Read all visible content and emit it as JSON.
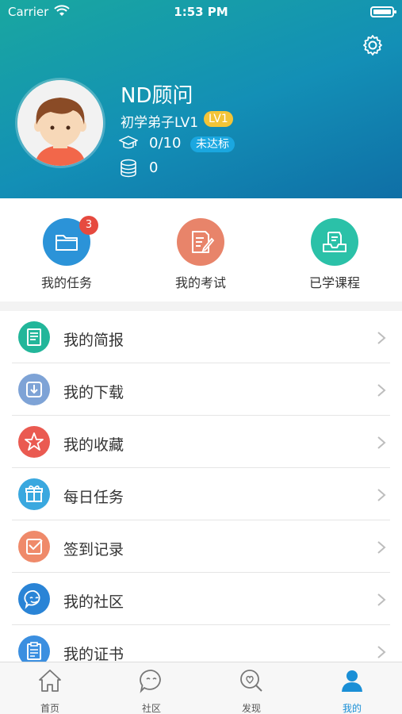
{
  "status_bar": {
    "carrier": "Carrier",
    "time": "1:53 PM"
  },
  "profile": {
    "name": "ND顾问",
    "level_title": "初学弟子LV1",
    "level_badge": "LV1",
    "progress": "0/10",
    "progress_status": "未达标",
    "coins": "0"
  },
  "quick_actions": {
    "tasks": {
      "label": "我的任务",
      "count": "3",
      "color": "#2b93d8"
    },
    "exams": {
      "label": "我的考试",
      "color": "#e8846a"
    },
    "courses": {
      "label": "已学课程",
      "color": "#2bc1a8"
    }
  },
  "menu": [
    {
      "label": "我的简报",
      "icon": "report-icon",
      "color": "#22b69a"
    },
    {
      "label": "我的下载",
      "icon": "download-icon",
      "color": "#7ea3d6"
    },
    {
      "label": "我的收藏",
      "icon": "star-icon",
      "color": "#ea5a51"
    },
    {
      "label": "每日任务",
      "icon": "gift-icon",
      "color": "#3aa8df"
    },
    {
      "label": "签到记录",
      "icon": "checkin-icon",
      "color": "#ef8a6a"
    },
    {
      "label": "我的社区",
      "icon": "chat-icon",
      "color": "#2a84d6"
    },
    {
      "label": "我的证书",
      "icon": "certificate-icon",
      "color": "#3b8fe0"
    }
  ],
  "tabs": {
    "home": "首页",
    "community": "社区",
    "discover": "发现",
    "mine": "我的"
  },
  "colors": {
    "accent": "#1a8fd6",
    "header_start": "#19a7a0",
    "header_end": "#0f6fa6"
  }
}
